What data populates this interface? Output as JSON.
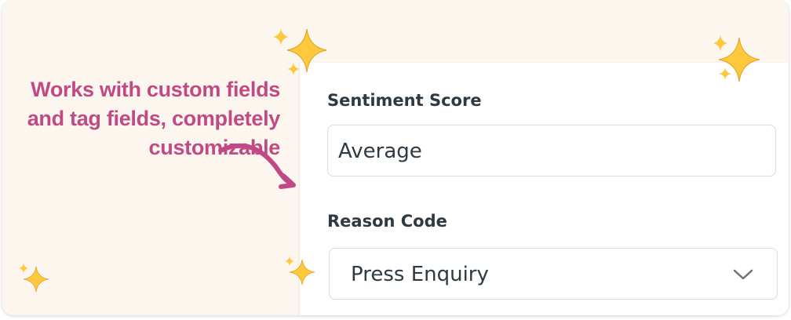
{
  "callout": {
    "lines": [
      "Works with custom fields",
      "and tag fields, completely",
      "customizable"
    ]
  },
  "form": {
    "sentiment_label": "Sentiment Score",
    "sentiment_value": "Average",
    "reason_label": "Reason Code",
    "reason_value": "Press Enquiry"
  },
  "colors": {
    "accent": "#c04a84",
    "background": "#fdf6ee",
    "sparkle": "#ffc83d"
  }
}
